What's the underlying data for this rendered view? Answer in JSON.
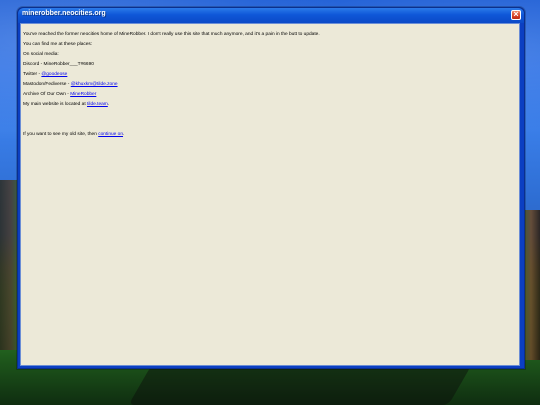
{
  "window": {
    "title": "minerobber.neocities.org",
    "close_icon": "close-icon"
  },
  "content": {
    "lines": [
      {
        "text": "You've reached the former neocities home of MineRobber. I don't really use this site that much anymore, and it's a pain in the butt to update."
      },
      {
        "text": "You can find me at these places:"
      },
      {
        "text": "On social media:"
      },
      {
        "text": "Discord - MineRobber___T#6690"
      },
      {
        "prefix": "Twitter - ",
        "link": "@goodeose"
      },
      {
        "prefix": "Mastodon/Fediverse - ",
        "link": "@khuxkm@tilde.zone"
      },
      {
        "prefix": "Archive Of Our Own - ",
        "link": "MineRobber"
      },
      {
        "prefix": "My main website is located at ",
        "link": "tilde.team",
        "suffix": "."
      },
      {
        "prefix": "If you want to see my old site, then ",
        "link": "continue on",
        "suffix": "."
      }
    ]
  },
  "colors": {
    "window_body": "#ece9d8",
    "titlebar_blue": "#0b49c7",
    "link": "#0000ee"
  }
}
